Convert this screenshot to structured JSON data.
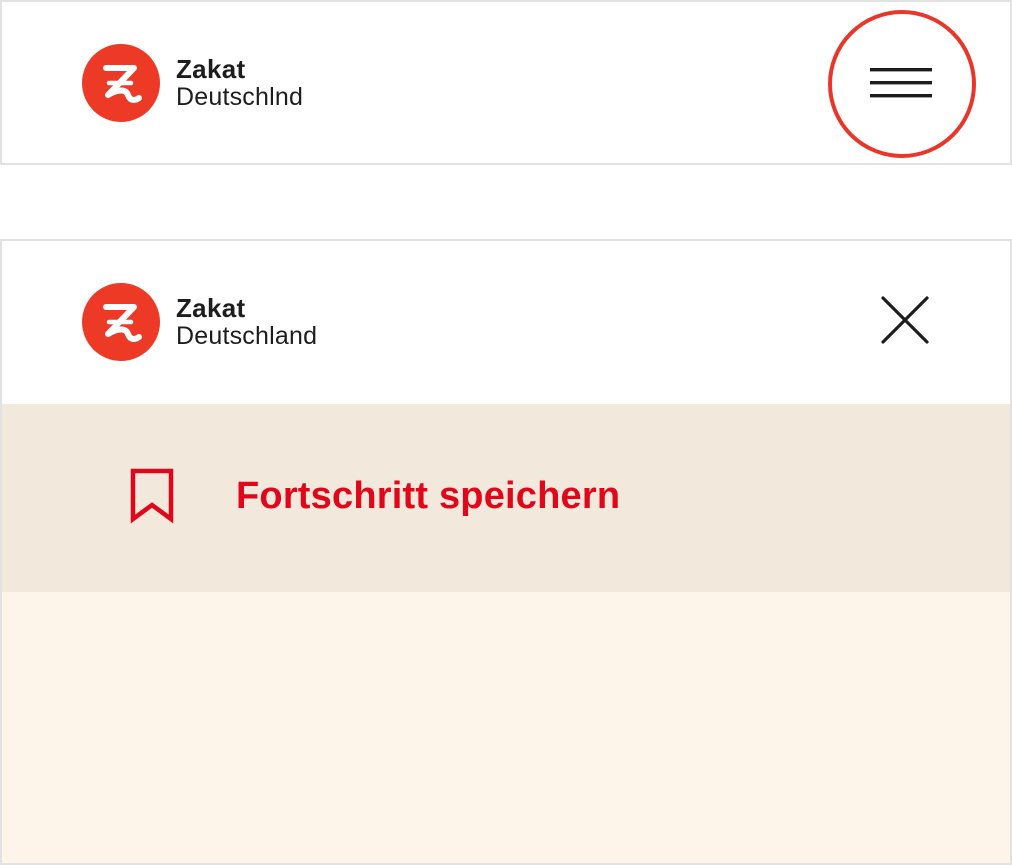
{
  "header_collapsed": {
    "logo": {
      "title": "Zakat",
      "subtitle": "Deutschlnd",
      "badge_icon": "z-logo-icon"
    },
    "menu_icon": "hamburger-menu-icon",
    "highlight_color": "#e8372a"
  },
  "header_expanded": {
    "logo": {
      "title": "Zakat",
      "subtitle": "Deutschland",
      "badge_icon": "z-logo-icon"
    },
    "close_icon": "close-icon"
  },
  "menu": {
    "items": [
      {
        "label": "Fortschritt speichern",
        "icon": "bookmark-icon"
      }
    ]
  },
  "colors": {
    "brand": "#ec3a26",
    "link_red": "#e0071b",
    "menu_item_bg": "#f2e9dc",
    "menu_body_bg": "#fdf5e9"
  }
}
